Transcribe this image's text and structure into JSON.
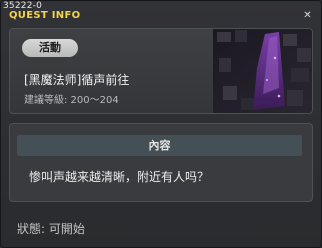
{
  "window": {
    "quest_id": "35222-0",
    "title": "QUEST INFO",
    "close_symbol": "✕"
  },
  "quest": {
    "category": "活動",
    "name": "[黑魔法师]循声前往",
    "level_requirement": "建議等級: 200～204",
    "thumbnail": "dark-cave-purple-crystal"
  },
  "content": {
    "header": "內容",
    "text": "惨叫声越来越清晰，附近有人吗？"
  },
  "status": "狀態: 可開始",
  "colors": {
    "title": "#f2d44a",
    "content_header_bg": "#445055"
  }
}
